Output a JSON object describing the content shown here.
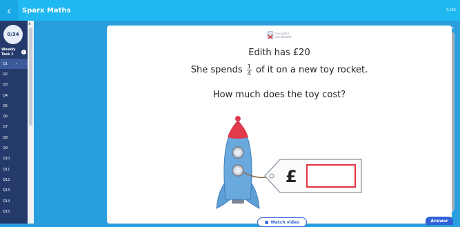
{
  "topbar": {
    "back_icon": "chevron-left-icon",
    "title": "Sparx Maths",
    "right_text": "3,583"
  },
  "sidebar": {
    "progress": "0/34",
    "weekly": "Weekly",
    "task": "Task 1",
    "info_icon": "info-icon",
    "questions": [
      {
        "label": "Q1",
        "active": true
      },
      {
        "label": "Q2"
      },
      {
        "label": "Q3"
      },
      {
        "label": "Q4"
      },
      {
        "label": "Q5"
      },
      {
        "label": "Q6"
      },
      {
        "label": "Q7"
      },
      {
        "label": "Q8"
      },
      {
        "label": "Q9"
      },
      {
        "label": "Q10"
      },
      {
        "label": "Q11"
      },
      {
        "label": "Q12"
      },
      {
        "label": "Q13"
      },
      {
        "label": "Q14"
      },
      {
        "label": "Q15"
      }
    ]
  },
  "question": {
    "calculator_line1": "Calculator",
    "calculator_line2": "not allowed",
    "line1": "Edith has £20",
    "line2_before": "She spends",
    "fraction_num": "1",
    "fraction_den": "4",
    "line2_after": "of it on a new toy rocket.",
    "line3": "How much does the toy cost?",
    "tag_symbol": "£"
  },
  "buttons": {
    "watch_video": "Watch video",
    "answer": "Answer"
  },
  "colors": {
    "topbar": "#1fb8f1",
    "sidebar": "#243a6b",
    "accent": "#2f63d6",
    "rocket_body": "#5e9fd6",
    "rocket_red": "#e03a4b",
    "answer_box": "#e8323f"
  }
}
